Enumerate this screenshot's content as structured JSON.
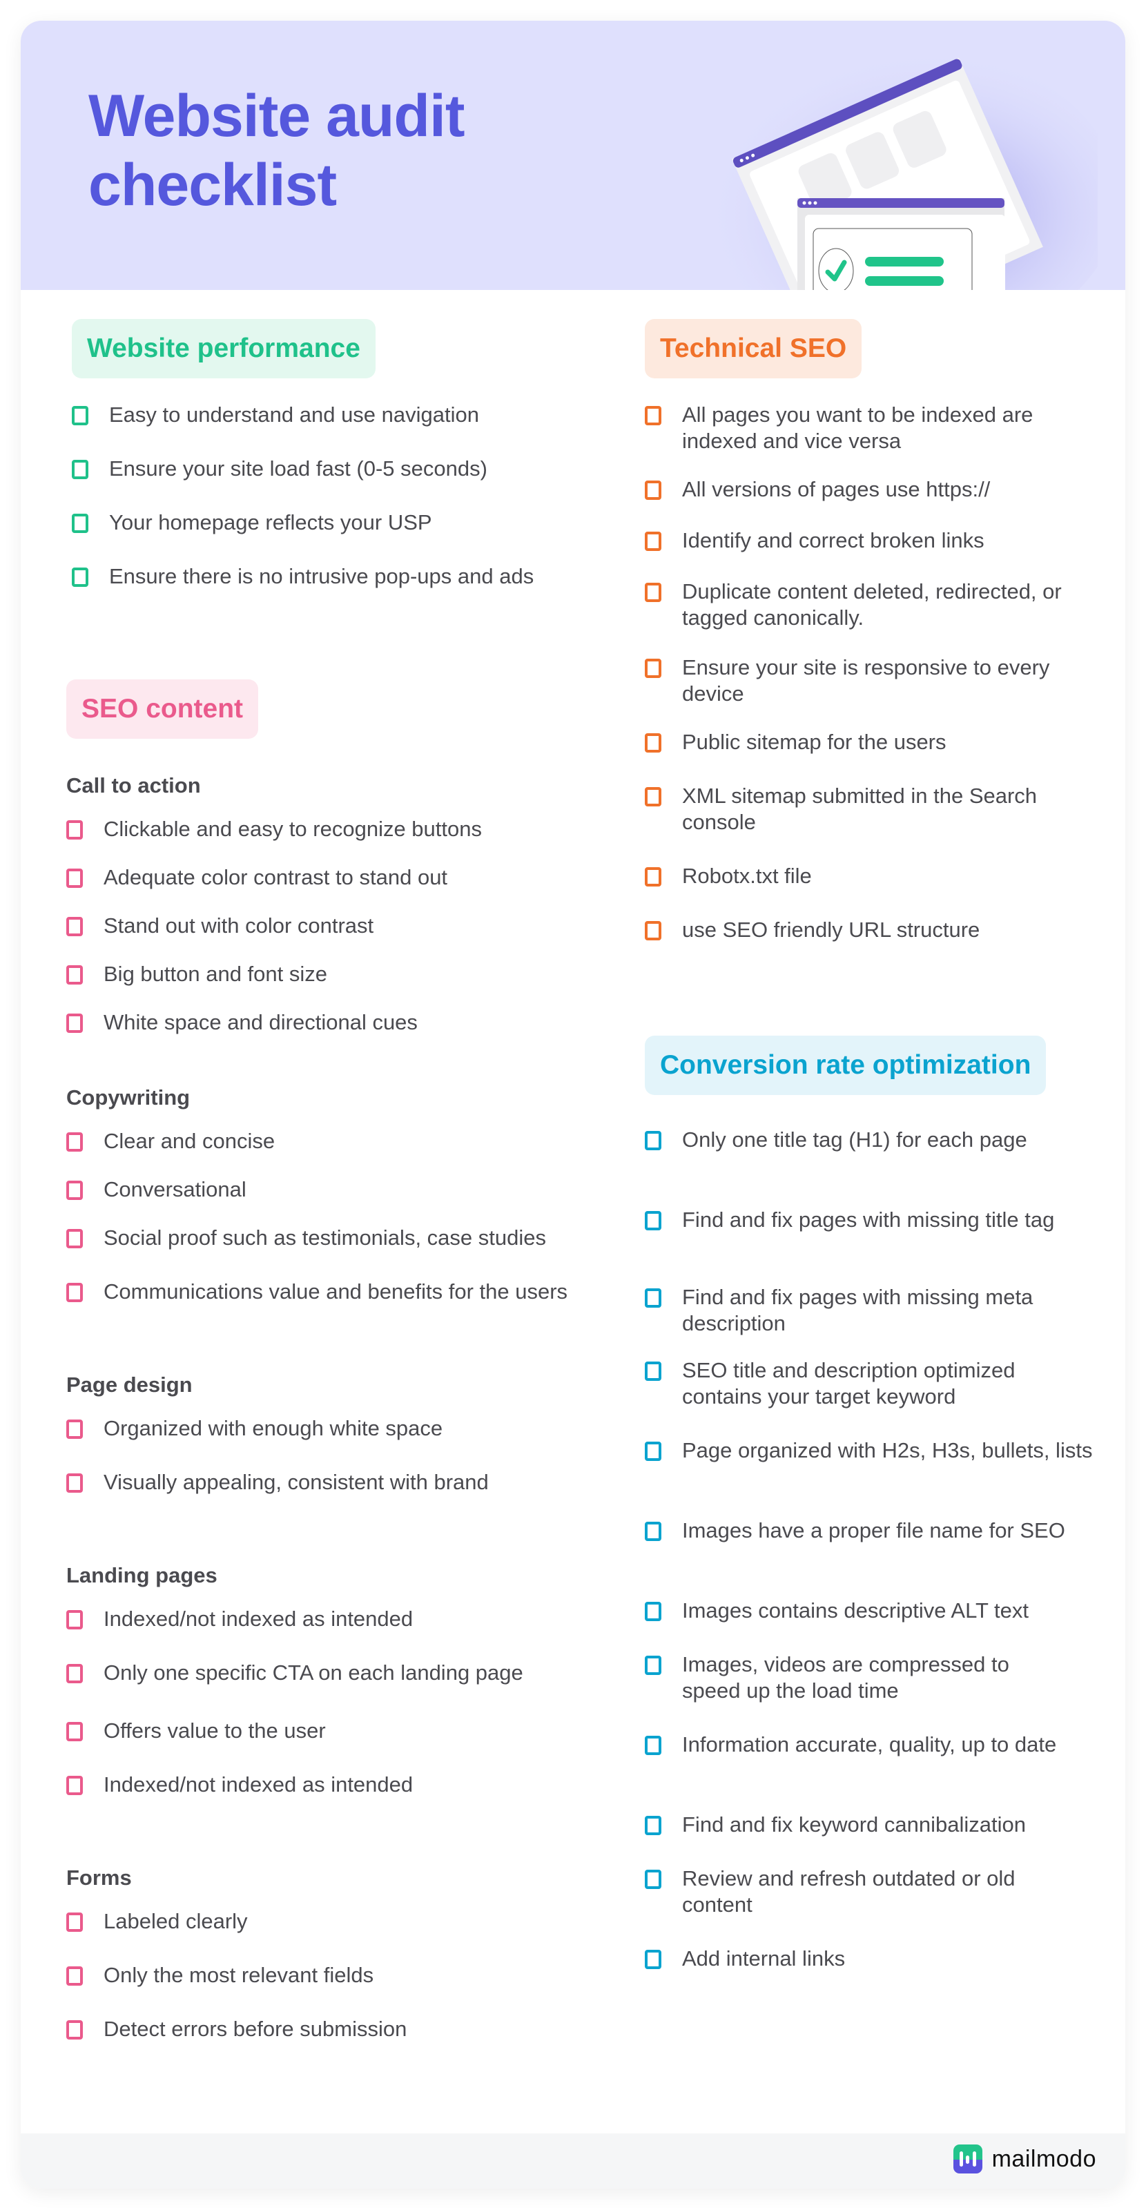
{
  "header": {
    "title": "Website audit\nchecklist",
    "colors": {
      "background": "#dfe0fd",
      "title": "#5558dd"
    }
  },
  "sections": {
    "website_performance": {
      "title": "Website performance",
      "color": "#1fc18a",
      "items": [
        "Easy to understand and use navigation",
        "Ensure your site load fast (0-5 seconds)",
        "Your homepage reflects your USP",
        "Ensure there is no intrusive pop-ups and ads"
      ]
    },
    "seo_content": {
      "title": "SEO content",
      "color": "#ea5a8c",
      "groups": [
        {
          "title": "Call to action",
          "items": [
            "Clickable and easy to recognize buttons",
            "Adequate color contrast to stand out",
            "Stand out with color contrast",
            "Big button and font size",
            "White space and directional cues"
          ]
        },
        {
          "title": "Copywriting",
          "items": [
            "Clear and concise",
            "Conversational",
            "Social proof such as testimonials, case studies",
            "Communications value and benefits for the users"
          ]
        },
        {
          "title": "Page design",
          "items": [
            "Organized with enough white space",
            "Visually appealing, consistent with brand"
          ]
        },
        {
          "title": "Landing pages",
          "items": [
            "Indexed/not indexed as intended",
            "Only one specific CTA on each landing page",
            "Offers value to the user",
            "Indexed/not indexed as intended"
          ]
        },
        {
          "title": "Forms",
          "items": [
            "Labeled clearly",
            "Only the most relevant fields",
            "Detect errors before submission"
          ]
        }
      ]
    },
    "technical_seo": {
      "title": "Technical SEO",
      "color": "#f0712a",
      "items": [
        "All pages you want to be indexed are indexed and vice versa",
        "All versions of pages use https://",
        "Identify and correct broken links",
        "Duplicate content deleted, redirected, or tagged canonically.",
        "Ensure your site is responsive to every device",
        "Public sitemap for the users",
        "XML sitemap submitted in the Search console",
        "Robotx.txt file",
        "use SEO friendly URL structure"
      ]
    },
    "conversion_rate_optimization": {
      "title": "Conversion rate optimization",
      "color": "#0aa3cf",
      "items": [
        "Only one title tag (H1) for each page",
        "Find and fix pages with missing title tag",
        "Find and fix pages with missing meta description",
        "SEO title and description optimized contains your target keyword",
        "Page organized with H2s, H3s, bullets, lists",
        "Images have a proper file name for SEO",
        "Images contains descriptive ALT text",
        "Images, videos are compressed to speed up the load time",
        "Information accurate, quality, up to date",
        "Find and fix keyword cannibalization",
        "Review and refresh outdated or old content",
        "Add internal links"
      ]
    }
  },
  "footer": {
    "brand": "mailmodo",
    "logo_icon": "mailmodo-logo-icon"
  }
}
